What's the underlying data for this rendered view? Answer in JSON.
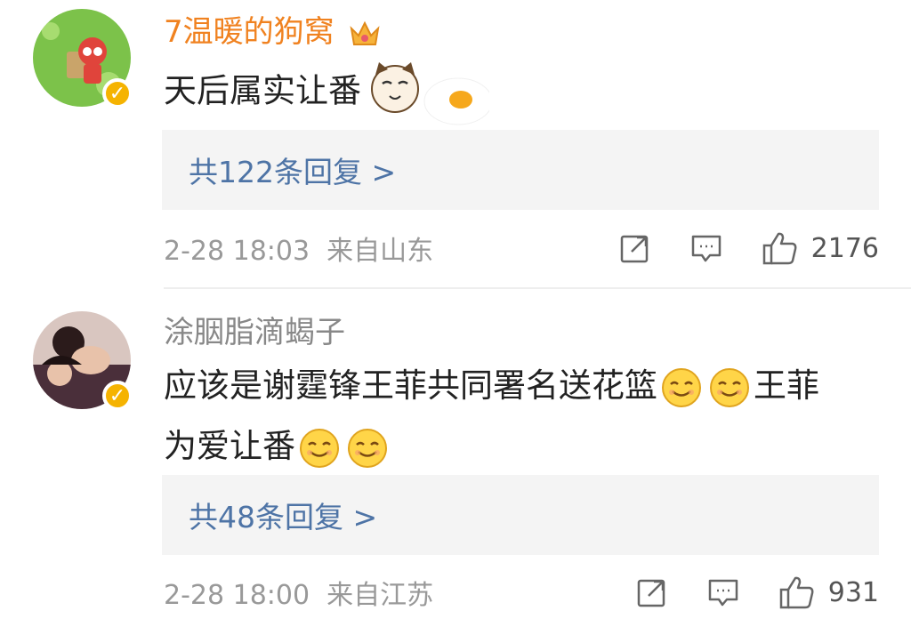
{
  "comments": [
    {
      "username": "7温暖的狗窝",
      "vip": true,
      "text": "天后属实让番",
      "emojis": [
        "cat-fried-egg-emoji"
      ],
      "replies_label": "共122条回复 >",
      "time": "2-28 18:03",
      "location": "来自山东",
      "likes": "2176"
    },
    {
      "username": "涂胭脂滴蝎子",
      "vip": false,
      "text_part1": "应该是谢霆锋王菲共同署名送花篮",
      "text_part2": "王菲",
      "text_part3": "为爱让番",
      "emojis": [
        "smile-emoji",
        "smile-emoji",
        "smile-emoji",
        "smile-emoji"
      ],
      "replies_label": "共48条回复 >",
      "time": "2-28 18:00",
      "location": "来自江苏",
      "likes": "931"
    }
  ],
  "colors": {
    "vip_name": "#f08220",
    "link": "#4e74a6",
    "meta": "#999999",
    "verified_badge": "#f5b301"
  }
}
